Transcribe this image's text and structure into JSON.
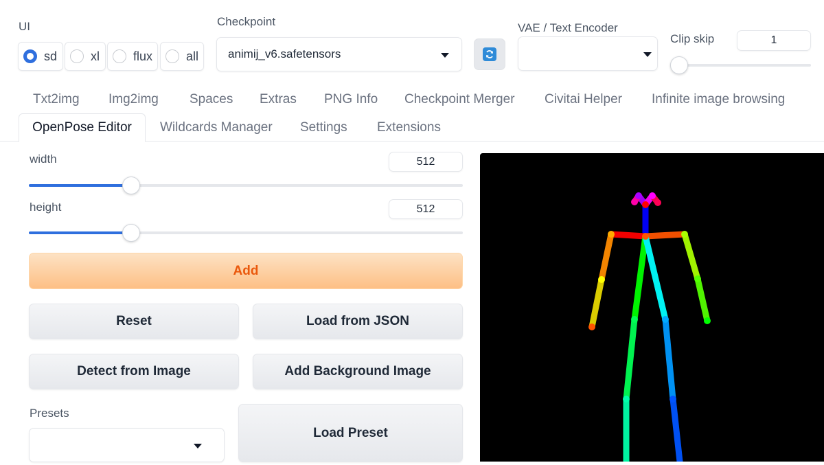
{
  "ui_group": {
    "label": "UI",
    "options": [
      {
        "label": "sd",
        "checked": true
      },
      {
        "label": "xl",
        "checked": false
      },
      {
        "label": "flux",
        "checked": false
      },
      {
        "label": "all",
        "checked": false
      }
    ]
  },
  "checkpoint": {
    "label": "Checkpoint",
    "value": "animij_v6.safetensors"
  },
  "vae": {
    "label": "VAE / Text Encoder",
    "value": ""
  },
  "clip_skip": {
    "label": "Clip skip",
    "value": "1",
    "slider_fraction": 0.0
  },
  "tabs_row1": [
    "Txt2img",
    "Img2img",
    "Spaces",
    "Extras",
    "PNG Info",
    "Checkpoint Merger",
    "Civitai Helper",
    "Infinite image browsing"
  ],
  "tabs_row2": [
    "OpenPose Editor",
    "Wildcards Manager",
    "Settings",
    "Extensions"
  ],
  "active_tab": "OpenPose Editor",
  "width": {
    "label": "width",
    "value": "512",
    "slider_fraction": 0.236
  },
  "height": {
    "label": "height",
    "value": "512",
    "slider_fraction": 0.236
  },
  "buttons": {
    "add": "Add",
    "reset": "Reset",
    "load_json": "Load from JSON",
    "detect": "Detect from Image",
    "add_background": "Add Background Image",
    "load_preset": "Load Preset"
  },
  "presets": {
    "label": "Presets",
    "value": ""
  },
  "colors": {
    "accent": "#2f6fde",
    "primary_text": "#ea580c",
    "canvas_bg": "#000000"
  }
}
